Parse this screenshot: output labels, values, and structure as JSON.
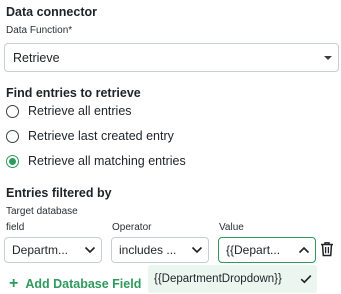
{
  "data_connector": {
    "heading": "Data connector",
    "function_label": "Data Function*",
    "function_value": "Retrieve"
  },
  "find_entries": {
    "heading": "Find entries to retrieve",
    "options": [
      {
        "label": "Retrieve all entries",
        "checked": false
      },
      {
        "label": "Retrieve last created entry",
        "checked": false
      },
      {
        "label": "Retrieve all matching entries",
        "checked": true
      }
    ]
  },
  "filters": {
    "heading": "Entries filtered by",
    "field_label_line1": "Target database",
    "field_label_line2": "field",
    "operator_label": "Operator",
    "value_label": "Value",
    "field_value": "Departm...",
    "operator_value": "includes ...",
    "value_value": "{{Depart...",
    "dropdown_option": "{{DepartmentDropdown}}"
  },
  "add_field": {
    "plus": "+",
    "label": "Add Database Field"
  },
  "colors": {
    "accent": "#2e9a5b",
    "option_highlight": "#eaf6ef"
  }
}
